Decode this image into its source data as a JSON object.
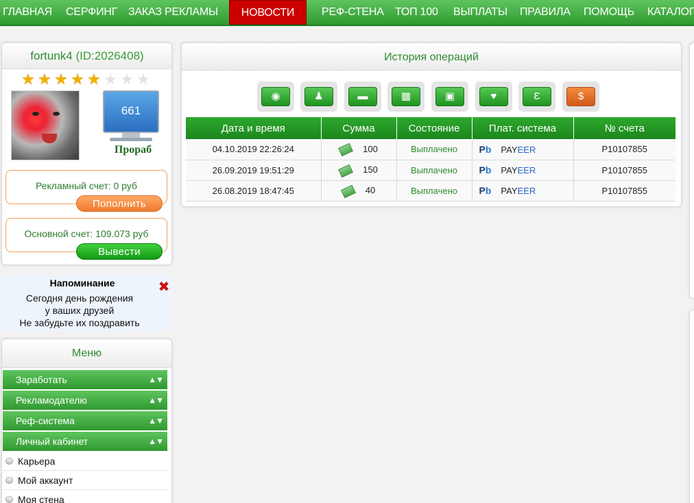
{
  "nav": {
    "items": [
      {
        "label": "ГЛАВНАЯ",
        "active": false
      },
      {
        "label": "СЕРФИНГ",
        "active": false
      },
      {
        "label": "ЗАКАЗ РЕКЛАМЫ",
        "active": false
      },
      {
        "label": "НОВОСТИ",
        "active": true
      },
      {
        "label": "РЕФ-СТЕНА",
        "active": false
      },
      {
        "label": "ТОП 100",
        "active": false
      },
      {
        "label": "ВЫПЛАТЫ",
        "active": false
      },
      {
        "label": "ПРАВИЛА",
        "active": false
      },
      {
        "label": "ПОМОЩЬ",
        "active": false
      },
      {
        "label": "КАТАЛОГ",
        "active": false
      }
    ]
  },
  "profile": {
    "username": "fortunk4",
    "id_label": "(ID:2026408)",
    "stars_total": 8,
    "stars_filled": 5,
    "monitor_value": "661",
    "rank": "Прораб"
  },
  "accounts": {
    "ad_text": "Рекламный счет: 0 руб",
    "ad_button": "Пополнить",
    "main_text": "Основной счет: 109.073 руб",
    "main_button": "Вывести"
  },
  "reminder": {
    "title": "Напоминание",
    "line1": "Сегодня день рождения",
    "line2": "у ваших друзей",
    "line3": "Не забудьте их поздравить",
    "close": "✖"
  },
  "menu": {
    "title": "Меню",
    "sections": [
      {
        "label": "Заработать"
      },
      {
        "label": "Рекламодателю"
      },
      {
        "label": "Реф-система"
      },
      {
        "label": "Личный кабинет"
      }
    ],
    "subitems": [
      {
        "label": "Карьера"
      },
      {
        "label": "Мой аккаунт"
      },
      {
        "label": "Моя стена"
      }
    ],
    "arrows": "▲▼"
  },
  "history": {
    "title": "История операций",
    "icons": [
      {
        "name": "globe-icon",
        "glyph": "◉"
      },
      {
        "name": "users-icon",
        "glyph": "♟"
      },
      {
        "name": "wallet-icon",
        "glyph": "▬"
      },
      {
        "name": "calendar-icon",
        "glyph": "▦"
      },
      {
        "name": "lock-icon",
        "glyph": "▣"
      },
      {
        "name": "wine-icon",
        "glyph": "♥"
      },
      {
        "name": "e-letter-icon",
        "glyph": "Ɛ"
      },
      {
        "name": "money-bag-icon",
        "glyph": "$"
      }
    ],
    "columns": [
      "Дата и время",
      "Сумма",
      "Состояние",
      "Плат. система",
      "№ счета"
    ],
    "rows": [
      {
        "date": "04.10.2019 22:26:24",
        "amount": "100",
        "state": "Выплачено",
        "system_pre": "PAY",
        "system_post": "EER",
        "account": "P10107855"
      },
      {
        "date": "26.09.2019 19:51:29",
        "amount": "150",
        "state": "Выплачено",
        "system_pre": "PAY",
        "system_post": "EER",
        "account": "P10107855"
      },
      {
        "date": "26.08.2019 18:47:45",
        "amount": "40",
        "state": "Выплачено",
        "system_pre": "PAY",
        "system_post": "EER",
        "account": "P10107855"
      }
    ],
    "pb_p": "P",
    "pb_b": "b"
  },
  "colors": {
    "brand_green": "#2f9a2f",
    "active_red": "#cc0000",
    "link_green": "#2e8b2e",
    "orange": "#ef7b2e"
  }
}
